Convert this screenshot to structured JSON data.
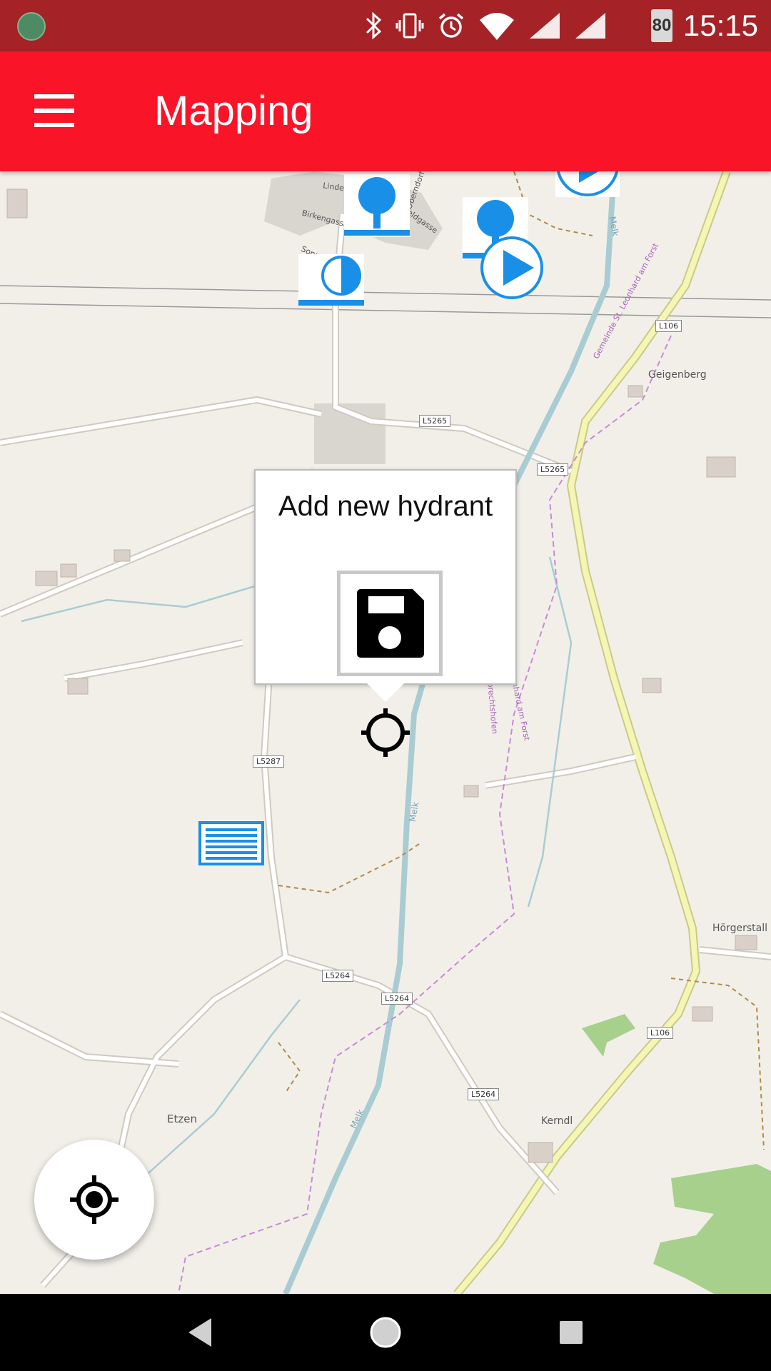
{
  "status_bar": {
    "battery": "80",
    "time": "15:15",
    "icons": [
      "bluetooth-icon",
      "vibrate-icon",
      "alarm-icon",
      "wifi-icon",
      "signal-icon",
      "signal-icon"
    ]
  },
  "app_bar": {
    "title": "Mapping",
    "menu_icon": "hamburger-menu-icon",
    "color": "#fa1428"
  },
  "map": {
    "place_labels": [
      "Geigenberg",
      "Hörgerstall",
      "Etzen",
      "Kerndl"
    ],
    "road_labels": [
      "L106",
      "L5265",
      "L5265",
      "L5287",
      "L5264",
      "L5264",
      "L5264",
      "L106"
    ],
    "street_labels": [
      "Lindengasse",
      "Birkengasse",
      "Sonnweg",
      "Feldgasse",
      "Oberndorf"
    ],
    "river_labels": [
      "Melk",
      "Melk",
      "Melk"
    ],
    "boundary_labels": [
      "Gemeinde St. Leonhard am Forst",
      "Leonhard am Forst",
      "Ruprechtshofen"
    ],
    "marker_color": "#1a8fe8",
    "markers": [
      {
        "type": "hydrant-marker-icon"
      },
      {
        "type": "hydrant-marker-icon"
      },
      {
        "type": "hydrant-marker-icon"
      },
      {
        "type": "hydrant-marker-icon"
      },
      {
        "type": "hydrant-half-marker-icon"
      },
      {
        "type": "pump-play-marker-icon"
      },
      {
        "type": "pump-play-marker-icon"
      },
      {
        "type": "pump-play-marker-icon"
      },
      {
        "type": "water-tank-marker-icon"
      }
    ]
  },
  "popup": {
    "title": "Add new hydrant",
    "save_icon": "floppy-disk-save-icon"
  },
  "fab": {
    "icon": "my-location-icon"
  },
  "nav_bar": {
    "back_icon": "back-triangle-icon",
    "home_icon": "home-circle-icon",
    "recents_icon": "recents-square-icon"
  }
}
